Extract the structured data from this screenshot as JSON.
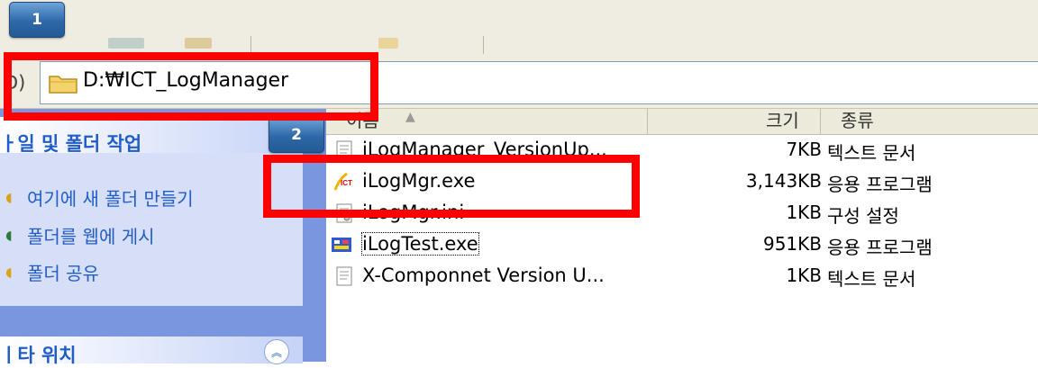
{
  "badges": {
    "step1": "1",
    "step2": "2"
  },
  "address": {
    "label": "D)",
    "path": "D:₩ICT_LogManager"
  },
  "task_pane": {
    "section_title": "ㅏ일 및 폴더 작업",
    "items": [
      {
        "label": "여기에 새 폴더 만들기",
        "icon": "new-folder-icon"
      },
      {
        "label": "폴더를 웹에 게시",
        "icon": "publish-web-icon"
      },
      {
        "label": "폴더 공유",
        "icon": "share-folder-icon"
      }
    ],
    "section2_title": "ㅣ타 위치",
    "collapse_glyph": "︽"
  },
  "columns": {
    "name": "이름",
    "size": "크기",
    "type": "종류",
    "sort_glyph": "▲"
  },
  "files": [
    {
      "name": "iLogManager_VersionUp...",
      "size": "7KB",
      "type": "텍스트 문서",
      "icon": "text-file-icon"
    },
    {
      "name": "iLogMgr.exe",
      "size": "3,143KB",
      "type": "응용 프로그램",
      "icon": "ict-app-icon"
    },
    {
      "name": "iLogMgr.ini",
      "size": "1KB",
      "type": "구성 설정",
      "icon": "config-file-icon"
    },
    {
      "name": "iLogTest.exe",
      "size": "951KB",
      "type": "응용 프로그램",
      "icon": "app-icon"
    },
    {
      "name": "X-Componnet Version U...",
      "size": "1KB",
      "type": "텍스트 문서",
      "icon": "text-file-icon"
    }
  ],
  "colors": {
    "highlight": "#ff0000",
    "badge": "#2e68a8",
    "task_link": "#215dc6",
    "task_bg": "#d6dff7"
  }
}
